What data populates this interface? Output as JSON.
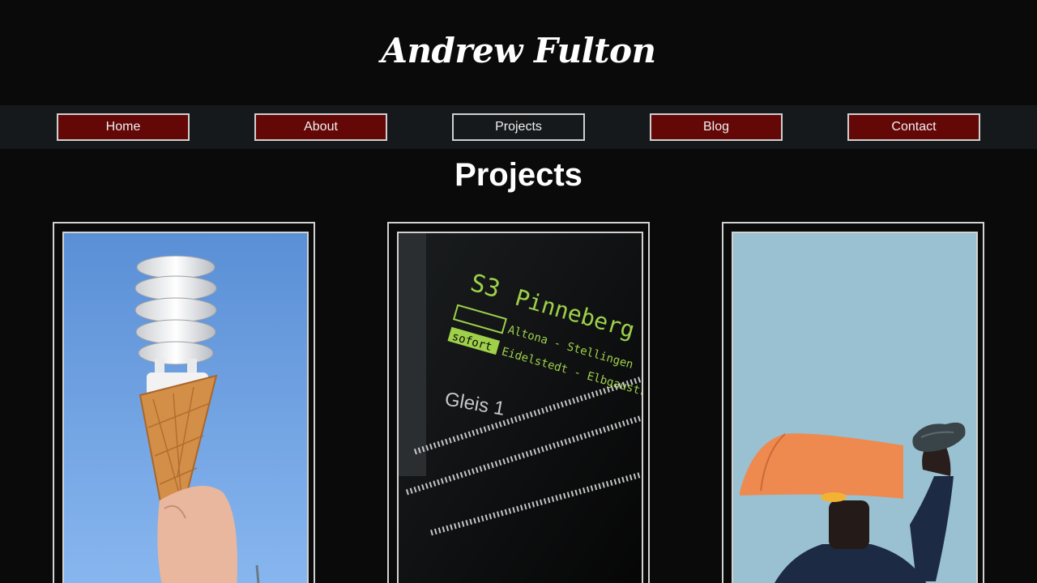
{
  "header": {
    "site_title": "Andrew Fulton"
  },
  "nav": {
    "items": [
      {
        "label": "Home",
        "active": false
      },
      {
        "label": "About",
        "active": false
      },
      {
        "label": "Projects",
        "active": true
      },
      {
        "label": "Blog",
        "active": false
      },
      {
        "label": "Contact",
        "active": false
      }
    ]
  },
  "main": {
    "heading": "Projects",
    "projects": [
      {
        "image": "lightbulb-in-ice-cream-cone-photo"
      },
      {
        "image": "train-departure-sign-photo",
        "sign": {
          "line": "S3",
          "destination": "Pinneberg",
          "via_1": "Altona - Stellingen",
          "status": "sofort",
          "via_2": "Eidelstedt - Elbgaustraße",
          "platform": "Gleis 1"
        }
      },
      {
        "image": "orange-paper-hat-portrait-photo"
      }
    ]
  },
  "colors": {
    "background": "#0b0a0b",
    "nav_bar": "#16191c",
    "button": "#640707",
    "border": "#d2d2d2"
  }
}
